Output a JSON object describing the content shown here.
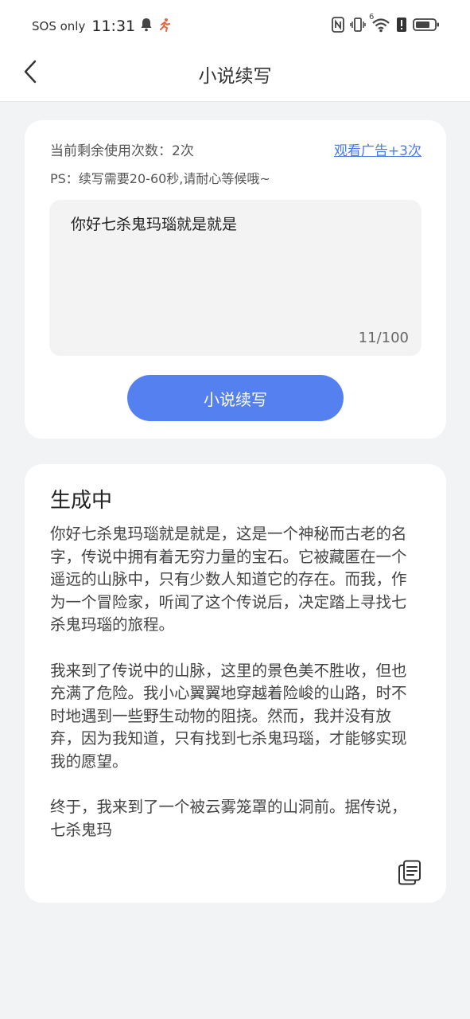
{
  "status_bar": {
    "carrier": "SOS only",
    "time": "11:31",
    "network_label": "6"
  },
  "app_bar": {
    "title": "小说续写"
  },
  "input_card": {
    "remaining_uses": "当前剩余使用次数：2次",
    "ad_link": "观看广告+3次",
    "ps_note": "PS：续写需要20-60秒,请耐心等候哦~",
    "input_value": "你好七杀鬼玛瑙就是就是",
    "char_count": "11/100",
    "submit_label": "小说续写"
  },
  "output_card": {
    "title": "生成中",
    "body": "你好七杀鬼玛瑙就是就是，这是一个神秘而古老的名字，传说中拥有着无穷力量的宝石。它被藏匿在一个遥远的山脉中，只有少数人知道它的存在。而我，作为一个冒险家，听闻了这个传说后，决定踏上寻找七杀鬼玛瑙的旅程。\n\n我来到了传说中的山脉，这里的景色美不胜收，但也充满了危险。我小心翼翼地穿越着险峻的山路，时不时地遇到一些野生动物的阻挠。然而，我并没有放弃，因为我知道，只有找到七杀鬼玛瑙，才能够实现我的愿望。\n\n终于，我来到了一个被云雾笼罩的山洞前。据传说，七杀鬼玛"
  },
  "colors": {
    "accent": "#5580f0",
    "link": "#4a7ae6",
    "page_bg": "#f2f3f5",
    "card_bg": "#ffffff",
    "input_bg": "#f3f3f3",
    "notification_icon": "#e8643c"
  },
  "icons": {
    "back": "chevron-left-icon",
    "bell": "bell-icon",
    "running": "running-person-icon",
    "nfc": "nfc-icon",
    "vibrate": "vibrate-icon",
    "wifi": "wifi-icon",
    "alert": "alert-icon",
    "battery": "battery-icon",
    "copy": "copy-icon"
  }
}
